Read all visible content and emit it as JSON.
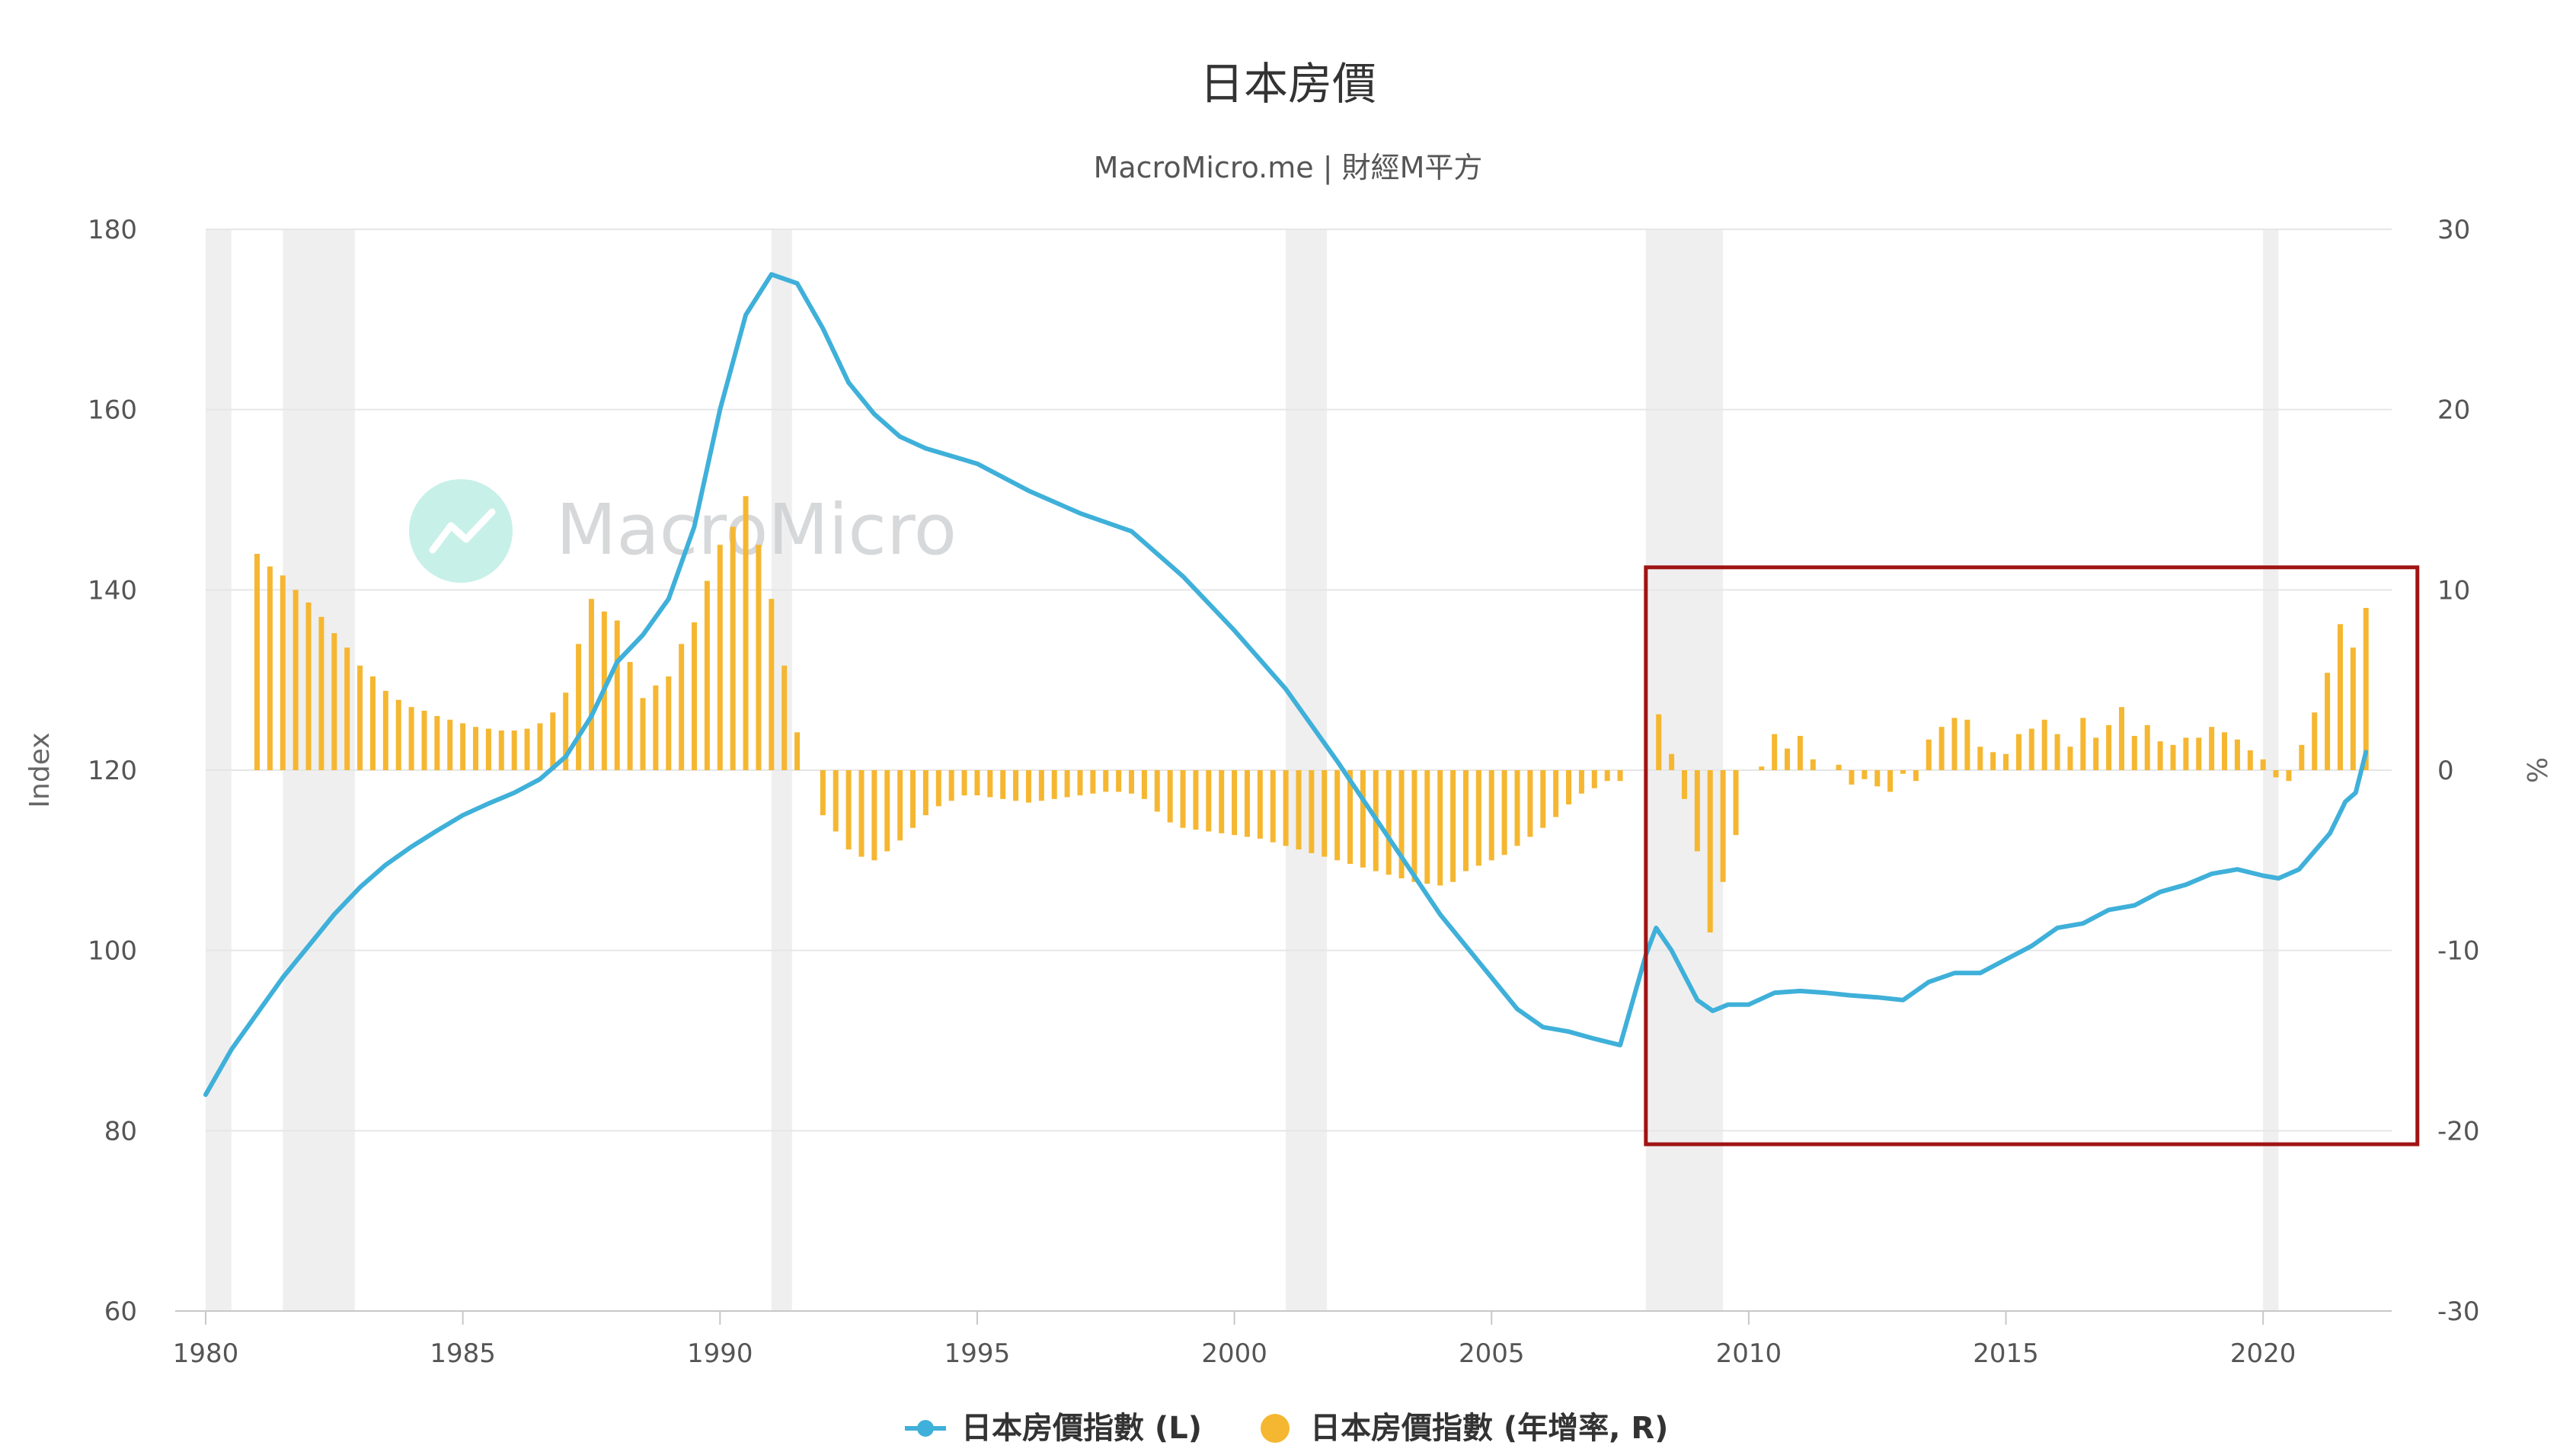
{
  "chart_data": {
    "type": "line+bar",
    "title": "日本房價",
    "subtitle": "MacroMicro.me | 財經M平方",
    "watermark": "MacroMicro",
    "y_left_label": "Index",
    "y_right_label": "%",
    "y_left_range": [
      60,
      180
    ],
    "y_right_range": [
      -30,
      30
    ],
    "y_left_ticks": [
      "60",
      "80",
      "100",
      "120",
      "140",
      "160",
      "180"
    ],
    "y_right_ticks": [
      "-30",
      "-20",
      "-10",
      "0",
      "10",
      "20",
      "30"
    ],
    "x_range": [
      1980,
      2022.5
    ],
    "x_ticks": [
      "1980",
      "1985",
      "1990",
      "1995",
      "2000",
      "2005",
      "2010",
      "2015",
      "2020"
    ],
    "grid": true,
    "legend_position": "bottom",
    "colors": {
      "line": "#3fb0d9",
      "bar": "#f5b731",
      "recession": "#efefef",
      "highlight": "#a01414",
      "grid": "#e6e6e6",
      "watermark": "#b9ece2"
    },
    "recession_periods": [
      [
        1980.0,
        1980.5
      ],
      [
        1981.5,
        1982.9
      ],
      [
        1991.0,
        1991.4
      ],
      [
        2001.0,
        2001.8
      ],
      [
        2008.0,
        2009.5
      ],
      [
        2020.0,
        2020.3
      ]
    ],
    "highlight_range": {
      "x": [
        2008.0,
        2023.0
      ],
      "y_left": [
        78.5,
        142.5
      ]
    },
    "series": [
      {
        "name": "日本房價指數 (L)",
        "axis": "left",
        "chart": "line",
        "points": [
          [
            1980.0,
            84
          ],
          [
            1980.5,
            89
          ],
          [
            1981.0,
            93
          ],
          [
            1981.5,
            97
          ],
          [
            1982.0,
            100.5
          ],
          [
            1982.5,
            104
          ],
          [
            1983.0,
            107
          ],
          [
            1983.5,
            109.5
          ],
          [
            1984.0,
            111.5
          ],
          [
            1984.5,
            113.3
          ],
          [
            1985.0,
            115
          ],
          [
            1985.5,
            116.3
          ],
          [
            1986.0,
            117.5
          ],
          [
            1986.5,
            119
          ],
          [
            1987.0,
            121.5
          ],
          [
            1987.5,
            126
          ],
          [
            1988.0,
            132
          ],
          [
            1988.5,
            135
          ],
          [
            1989.0,
            139
          ],
          [
            1989.5,
            147
          ],
          [
            1990.0,
            160
          ],
          [
            1990.5,
            170.5
          ],
          [
            1991.0,
            175
          ],
          [
            1991.5,
            174
          ],
          [
            1992.0,
            169
          ],
          [
            1992.5,
            163
          ],
          [
            1993.0,
            159.5
          ],
          [
            1993.5,
            157
          ],
          [
            1994.0,
            155.7
          ],
          [
            1995.0,
            154
          ],
          [
            1996.0,
            151
          ],
          [
            1997.0,
            148.5
          ],
          [
            1998.0,
            146.5
          ],
          [
            1999.0,
            141.5
          ],
          [
            2000.0,
            135.5
          ],
          [
            2001.0,
            129
          ],
          [
            2002.0,
            121
          ],
          [
            2003.0,
            112.5
          ],
          [
            2004.0,
            104
          ],
          [
            2005.0,
            97
          ],
          [
            2005.5,
            93.5
          ],
          [
            2006.0,
            91.5
          ],
          [
            2006.5,
            91
          ],
          [
            2007.0,
            90.2
          ],
          [
            2007.5,
            89.5
          ],
          [
            2008.0,
            99.5
          ],
          [
            2008.2,
            102.5
          ],
          [
            2008.5,
            100
          ],
          [
            2009.0,
            94.5
          ],
          [
            2009.3,
            93.3
          ],
          [
            2009.6,
            94
          ],
          [
            2010.0,
            94
          ],
          [
            2010.5,
            95.3
          ],
          [
            2011.0,
            95.5
          ],
          [
            2011.5,
            95.3
          ],
          [
            2012.0,
            95
          ],
          [
            2012.5,
            94.8
          ],
          [
            2013.0,
            94.5
          ],
          [
            2013.5,
            96.5
          ],
          [
            2014.0,
            97.5
          ],
          [
            2014.5,
            97.5
          ],
          [
            2015.0,
            99
          ],
          [
            2015.5,
            100.5
          ],
          [
            2016.0,
            102.5
          ],
          [
            2016.5,
            103
          ],
          [
            2017.0,
            104.5
          ],
          [
            2017.5,
            105
          ],
          [
            2018.0,
            106.5
          ],
          [
            2018.5,
            107.3
          ],
          [
            2019.0,
            108.5
          ],
          [
            2019.5,
            109
          ],
          [
            2020.0,
            108.3
          ],
          [
            2020.3,
            108
          ],
          [
            2020.7,
            109
          ],
          [
            2021.0,
            111
          ],
          [
            2021.3,
            113
          ],
          [
            2021.6,
            116.5
          ],
          [
            2021.8,
            117.5
          ],
          [
            2022.0,
            122
          ]
        ]
      },
      {
        "name": "日本房價指數 (年增率, R)",
        "axis": "right",
        "chart": "bar",
        "points": [
          [
            1981.0,
            12
          ],
          [
            1981.25,
            11.3
          ],
          [
            1981.5,
            10.8
          ],
          [
            1981.75,
            10
          ],
          [
            1982.0,
            9.3
          ],
          [
            1982.25,
            8.5
          ],
          [
            1982.5,
            7.6
          ],
          [
            1982.75,
            6.8
          ],
          [
            1983.0,
            5.8
          ],
          [
            1983.25,
            5.2
          ],
          [
            1983.5,
            4.4
          ],
          [
            1983.75,
            3.9
          ],
          [
            1984.0,
            3.5
          ],
          [
            1984.25,
            3.3
          ],
          [
            1984.5,
            3.0
          ],
          [
            1984.75,
            2.8
          ],
          [
            1985.0,
            2.6
          ],
          [
            1985.25,
            2.4
          ],
          [
            1985.5,
            2.3
          ],
          [
            1985.75,
            2.2
          ],
          [
            1986.0,
            2.2
          ],
          [
            1986.25,
            2.3
          ],
          [
            1986.5,
            2.6
          ],
          [
            1986.75,
            3.2
          ],
          [
            1987.0,
            4.3
          ],
          [
            1987.25,
            7.0
          ],
          [
            1987.5,
            9.5
          ],
          [
            1987.75,
            8.8
          ],
          [
            1988.0,
            8.3
          ],
          [
            1988.25,
            6.0
          ],
          [
            1988.5,
            4.0
          ],
          [
            1988.75,
            4.7
          ],
          [
            1989.0,
            5.2
          ],
          [
            1989.25,
            7.0
          ],
          [
            1989.5,
            8.2
          ],
          [
            1989.75,
            10.5
          ],
          [
            1990.0,
            12.5
          ],
          [
            1990.25,
            13.5
          ],
          [
            1990.5,
            15.2
          ],
          [
            1990.75,
            12.5
          ],
          [
            1991.0,
            9.5
          ],
          [
            1991.25,
            5.8
          ],
          [
            1991.5,
            2.1
          ],
          [
            1992.0,
            -2.5
          ],
          [
            1992.25,
            -3.4
          ],
          [
            1992.5,
            -4.4
          ],
          [
            1992.75,
            -4.8
          ],
          [
            1993.0,
            -5.0
          ],
          [
            1993.25,
            -4.5
          ],
          [
            1993.5,
            -3.9
          ],
          [
            1993.75,
            -3.2
          ],
          [
            1994.0,
            -2.5
          ],
          [
            1994.25,
            -2.0
          ],
          [
            1994.5,
            -1.7
          ],
          [
            1994.75,
            -1.4
          ],
          [
            1995.0,
            -1.4
          ],
          [
            1995.25,
            -1.5
          ],
          [
            1995.5,
            -1.6
          ],
          [
            1995.75,
            -1.7
          ],
          [
            1996.0,
            -1.8
          ],
          [
            1996.25,
            -1.7
          ],
          [
            1996.5,
            -1.6
          ],
          [
            1996.75,
            -1.5
          ],
          [
            1997.0,
            -1.4
          ],
          [
            1997.25,
            -1.3
          ],
          [
            1997.5,
            -1.2
          ],
          [
            1997.75,
            -1.2
          ],
          [
            1998.0,
            -1.3
          ],
          [
            1998.25,
            -1.6
          ],
          [
            1998.5,
            -2.3
          ],
          [
            1998.75,
            -2.9
          ],
          [
            1999.0,
            -3.2
          ],
          [
            1999.25,
            -3.3
          ],
          [
            1999.5,
            -3.4
          ],
          [
            1999.75,
            -3.5
          ],
          [
            2000.0,
            -3.6
          ],
          [
            2000.25,
            -3.7
          ],
          [
            2000.5,
            -3.8
          ],
          [
            2000.75,
            -4.0
          ],
          [
            2001.0,
            -4.2
          ],
          [
            2001.25,
            -4.4
          ],
          [
            2001.5,
            -4.6
          ],
          [
            2001.75,
            -4.8
          ],
          [
            2002.0,
            -5.0
          ],
          [
            2002.25,
            -5.2
          ],
          [
            2002.5,
            -5.4
          ],
          [
            2002.75,
            -5.6
          ],
          [
            2003.0,
            -5.8
          ],
          [
            2003.25,
            -6.0
          ],
          [
            2003.5,
            -6.2
          ],
          [
            2003.75,
            -6.3
          ],
          [
            2004.0,
            -6.4
          ],
          [
            2004.25,
            -6.2
          ],
          [
            2004.5,
            -5.6
          ],
          [
            2004.75,
            -5.3
          ],
          [
            2005.0,
            -5.0
          ],
          [
            2005.25,
            -4.7
          ],
          [
            2005.5,
            -4.2
          ],
          [
            2005.75,
            -3.7
          ],
          [
            2006.0,
            -3.2
          ],
          [
            2006.25,
            -2.6
          ],
          [
            2006.5,
            -1.9
          ],
          [
            2006.75,
            -1.3
          ],
          [
            2007.0,
            -1.0
          ],
          [
            2007.25,
            -0.6
          ],
          [
            2007.5,
            -0.6
          ],
          [
            2008.25,
            3.1
          ],
          [
            2008.5,
            0.9
          ],
          [
            2008.75,
            -1.6
          ],
          [
            2009.0,
            -4.5
          ],
          [
            2009.25,
            -9.0
          ],
          [
            2009.5,
            -6.2
          ],
          [
            2009.75,
            -3.6
          ],
          [
            2010.25,
            0.2
          ],
          [
            2010.5,
            2.0
          ],
          [
            2010.75,
            1.2
          ],
          [
            2011.0,
            1.9
          ],
          [
            2011.25,
            0.6
          ],
          [
            2011.75,
            0.3
          ],
          [
            2012.0,
            -0.8
          ],
          [
            2012.25,
            -0.5
          ],
          [
            2012.5,
            -0.9
          ],
          [
            2012.75,
            -1.2
          ],
          [
            2013.0,
            -0.2
          ],
          [
            2013.25,
            -0.6
          ],
          [
            2013.5,
            1.7
          ],
          [
            2013.75,
            2.4
          ],
          [
            2014.0,
            2.9
          ],
          [
            2014.25,
            2.8
          ],
          [
            2014.5,
            1.3
          ],
          [
            2014.75,
            1.0
          ],
          [
            2015.0,
            0.9
          ],
          [
            2015.25,
            2.0
          ],
          [
            2015.5,
            2.3
          ],
          [
            2015.75,
            2.8
          ],
          [
            2016.0,
            2.0
          ],
          [
            2016.25,
            1.3
          ],
          [
            2016.5,
            2.9
          ],
          [
            2016.75,
            1.8
          ],
          [
            2017.0,
            2.5
          ],
          [
            2017.25,
            3.5
          ],
          [
            2017.5,
            1.9
          ],
          [
            2017.75,
            2.5
          ],
          [
            2018.0,
            1.6
          ],
          [
            2018.25,
            1.4
          ],
          [
            2018.5,
            1.8
          ],
          [
            2018.75,
            1.8
          ],
          [
            2019.0,
            2.4
          ],
          [
            2019.25,
            2.1
          ],
          [
            2019.5,
            1.7
          ],
          [
            2019.75,
            1.1
          ],
          [
            2020.0,
            0.6
          ],
          [
            2020.25,
            -0.4
          ],
          [
            2020.5,
            -0.6
          ],
          [
            2020.75,
            1.4
          ],
          [
            2021.0,
            3.2
          ],
          [
            2021.25,
            5.4
          ],
          [
            2021.5,
            8.1
          ],
          [
            2021.75,
            6.8
          ],
          [
            2022.0,
            9.0
          ]
        ]
      }
    ]
  }
}
